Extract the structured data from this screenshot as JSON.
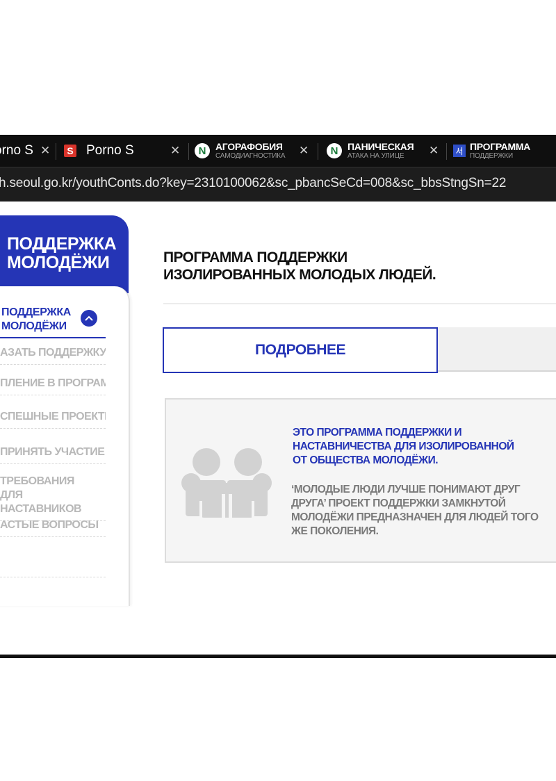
{
  "browser": {
    "tabs": [
      {
        "label": "orno S"
      },
      {
        "label": "Porno S"
      },
      {
        "title": "АГОРАФОБИЯ",
        "subtitle": "САМОДИАГНОСТИКА"
      },
      {
        "title": "ПАНИЧЕСКАЯ",
        "subtitle": "АТАКА НА УЛИЦЕ"
      },
      {
        "title": "ПРОГРАММА",
        "subtitle": "ПОДДЕРЖКИ"
      }
    ],
    "url": "h.seoul.go.kr/youthConts.do?key=2310100062&sc_pbancSeCd=008&sc_bbsStngSn=22"
  },
  "sidebar": {
    "title": "ПОДДЕРЖКА МОЛОДЁЖИ",
    "active_item": "ПОДДЕРЖКА МОЛОДЁЖИ",
    "items": [
      "АЗАТЬ ПОДДЕРЖКУ",
      "ПЛЕНИЕ В ПРОГРАММУ",
      "СПЕШНЫЕ ПРОЕКТЫ",
      " ПРИНЯТЬ УЧАСТИЕ",
      "ТРЕБОВАНИЯ\nДЛЯ НАСТАВНИКОВ",
      "АСТЫЕ ВОПРОСЫ"
    ]
  },
  "main": {
    "title": "ПРОГРАММА ПОДДЕРЖКИ ИЗОЛИРОВАННЫХ МОЛОДЫХ ЛЮДЕЙ.",
    "tab_detail": "ПОДРОБНЕЕ",
    "info": {
      "highlight": "ЭТО ПРОГРАММА ПОДДЕРЖКИ И НАСТАВНИЧЕСТВА ДЛЯ ИЗОЛИРОВАННОЙ ОТ ОБЩЕСТВА МОЛОДЁЖИ.",
      "text": "‘МОЛОДЫЕ ЛЮДИ ЛУЧШЕ ПОНИМАЮТ ДРУГ ДРУГА’ ПРОЕКТ ПОДДЕРЖКИ ЗАМКНУТОЙ МОЛОДЁЖИ ПРЕДНАЗНАЧЕН ДЛЯ ЛЮДЕЙ ТОГО ЖЕ ПОКОЛЕНИЯ."
    }
  },
  "colors": {
    "brand_blue": "#2535b6",
    "chrome_dark": "#0f0f0f",
    "muted_text": "#b8b8b8"
  },
  "icons": {
    "tab_close": "close-icon",
    "submenu_toggle": "chevron-up-icon",
    "illustration": "people-icon"
  }
}
